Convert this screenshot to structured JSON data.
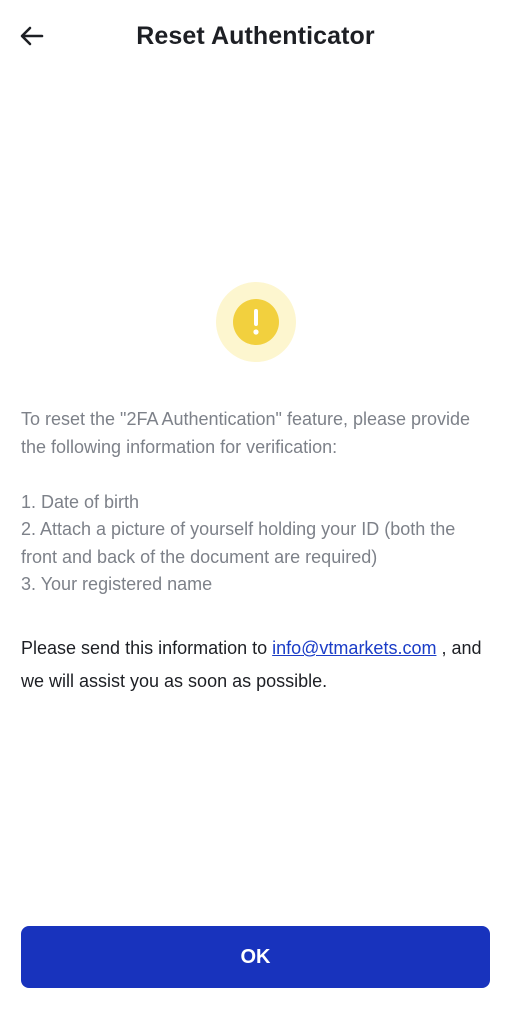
{
  "header": {
    "title": "Reset Authenticator",
    "back_icon": "arrow-left-icon"
  },
  "warning": {
    "icon": "exclamation-icon",
    "outer_color": "#fdf6cf",
    "inner_color": "#f2d03e"
  },
  "instructions": {
    "intro": "To reset the \"2FA Authentication\" feature, please provide the following information for verification:",
    "items": [
      "1. Date of birth",
      "2. Attach a picture of yourself holding your ID (both the front and back of the document are required)",
      "3. Your registered name"
    ]
  },
  "contact": {
    "prefix": "Please send this information to ",
    "email": "info@vtmarkets.com",
    "suffix": " , and we will assist you as soon as possible."
  },
  "footer": {
    "ok_label": "OK",
    "button_color": "#1833bd"
  }
}
